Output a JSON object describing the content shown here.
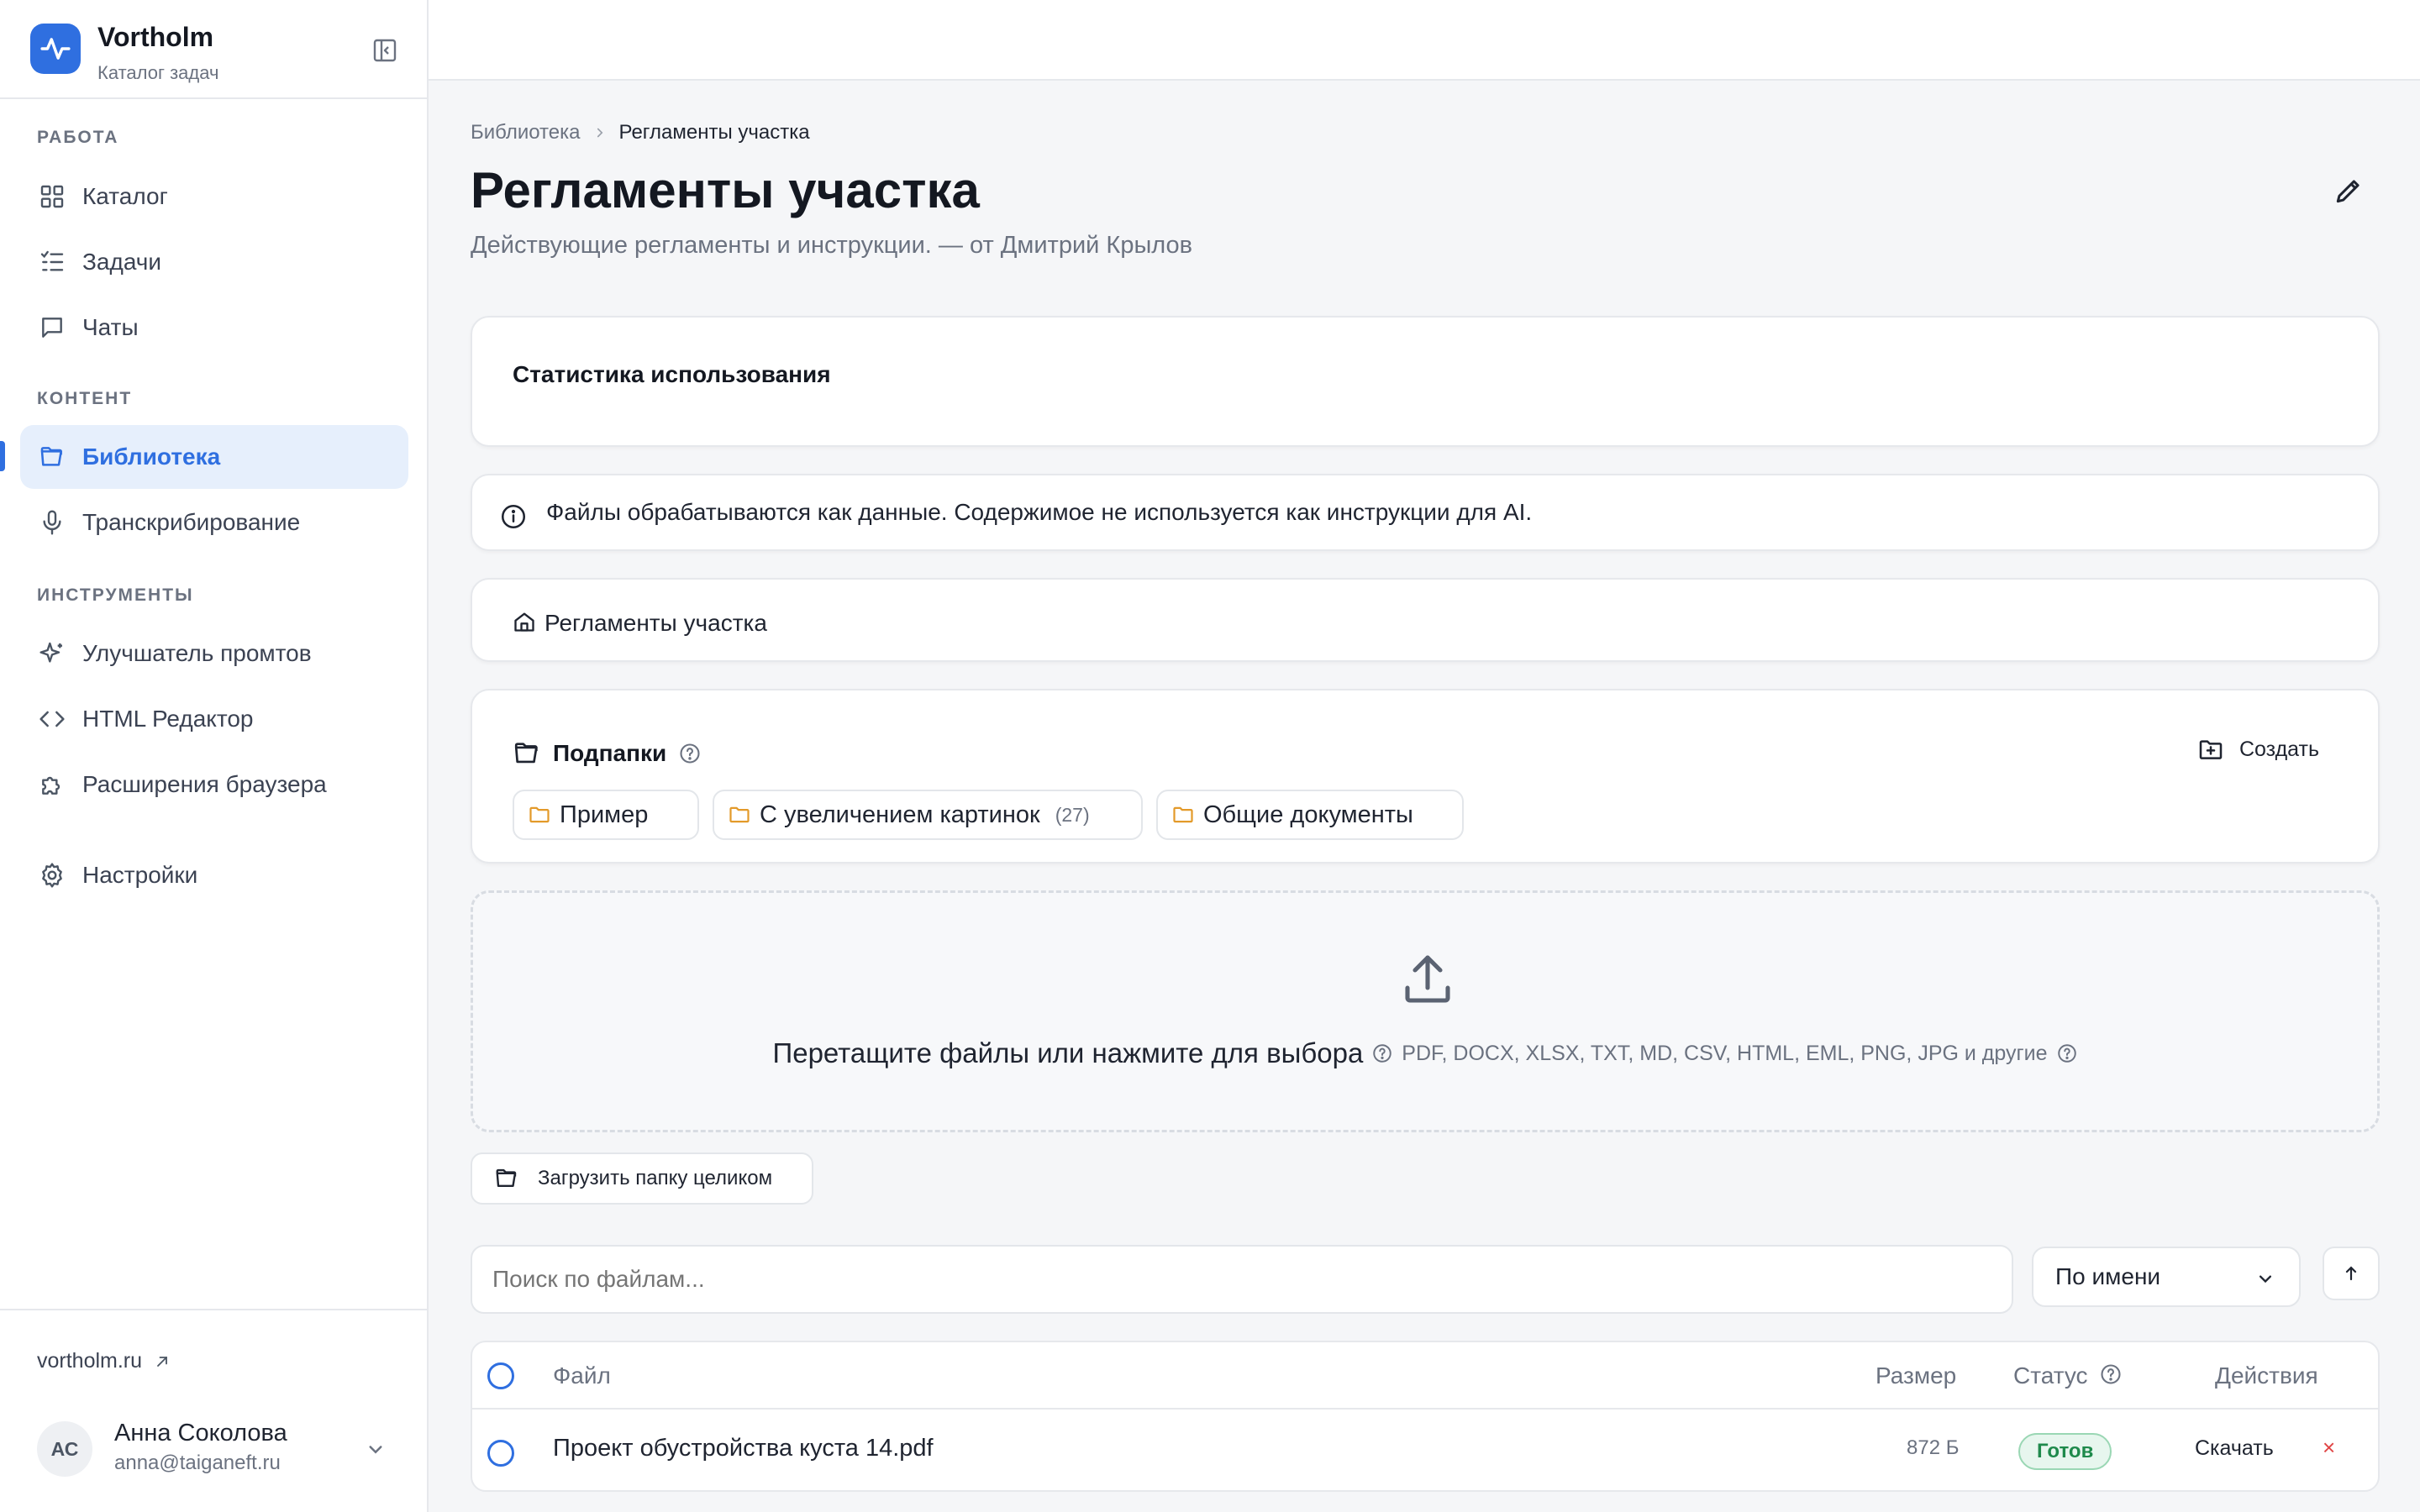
{
  "brand": {
    "name": "Vortholm",
    "subtitle": "Каталог задач"
  },
  "nav": {
    "sections": [
      {
        "label": "РАБОТА"
      },
      {
        "label": "КОНТЕНТ"
      },
      {
        "label": "ИНСТРУМЕНТЫ"
      }
    ],
    "items": [
      {
        "label": "Каталог",
        "icon": "grid-icon"
      },
      {
        "label": "Задачи",
        "icon": "list-check-icon"
      },
      {
        "label": "Чаты",
        "icon": "chat-icon"
      },
      {
        "label": "Библиотека",
        "icon": "folder-open-icon",
        "active": true
      },
      {
        "label": "Транскрибирование",
        "icon": "microphone-icon"
      },
      {
        "label": "Улучшатель промтов",
        "icon": "sparkles-icon"
      },
      {
        "label": "HTML Редактор",
        "icon": "code-icon"
      },
      {
        "label": "Расширения браузера",
        "icon": "puzzle-icon"
      },
      {
        "label": "Настройки",
        "icon": "gear-icon"
      }
    ],
    "external_link": "vortholm.ru"
  },
  "user": {
    "initials": "АС",
    "name": "Анна Соколова",
    "email": "anna@taiganeft.ru"
  },
  "breadcrumb": {
    "root": "Библиотека",
    "current": "Регламенты участка"
  },
  "page": {
    "title": "Регламенты участка",
    "subtitle": "Действующие регламенты и инструкции. — от Дмитрий Крылов"
  },
  "stats": {
    "title": "Статистика использования"
  },
  "notice": {
    "text": "Файлы обрабатываются как данные. Содержимое не используется как инструкции для AI."
  },
  "path": {
    "label": "Регламенты участка"
  },
  "subfolders": {
    "title": "Подпапки",
    "create_label": "Создать",
    "folders": [
      {
        "name": "Пример",
        "count": ""
      },
      {
        "name": "С увеличением картинок",
        "count": "(27)"
      },
      {
        "name": "Общие документы",
        "count": ""
      }
    ]
  },
  "dropzone": {
    "main_text": "Перетащите файлы или нажмите для выбора",
    "formats": "PDF, DOCX, XLSX, TXT, MD, CSV, HTML, EML, PNG, JPG и другие"
  },
  "folder_upload_label": "Загрузить папку целиком",
  "search": {
    "placeholder": "Поиск по файлам..."
  },
  "sort": {
    "selected": "По имени"
  },
  "table": {
    "columns": {
      "file": "Файл",
      "size": "Размер",
      "status": "Статус",
      "actions": "Действия"
    },
    "rows": [
      {
        "name": "Проект обустройства куста 14.pdf",
        "size": "872 Б",
        "status": "Готов",
        "action": "Скачать",
        "delete": "×"
      }
    ]
  },
  "colors": {
    "accent": "#2f6fe0",
    "status_ready": "#1f8a4c",
    "danger": "#e04444",
    "folder": "#e39a2a"
  }
}
